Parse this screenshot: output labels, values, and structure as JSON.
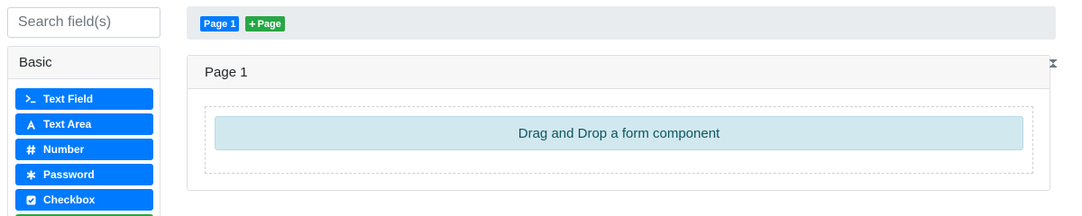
{
  "search": {
    "placeholder": "Search field(s)"
  },
  "builder": {
    "group_title": "Basic",
    "components": [
      {
        "label": "Text Field",
        "icon": "terminal-icon"
      },
      {
        "label": "Text Area",
        "icon": "font-icon"
      },
      {
        "label": "Number",
        "icon": "hashtag-icon"
      },
      {
        "label": "Password",
        "icon": "asterisk-icon"
      },
      {
        "label": "Checkbox",
        "icon": "check-square-icon"
      }
    ]
  },
  "wizard": {
    "page_tab": "Page 1",
    "add_page": "Page"
  },
  "page": {
    "title": "Page 1",
    "drop_text": "Drag and Drop a form component"
  },
  "colors": {
    "primary": "#007bff",
    "success": "#28a745",
    "info_bg": "#d1e8ef",
    "info_text": "#0c5460"
  }
}
